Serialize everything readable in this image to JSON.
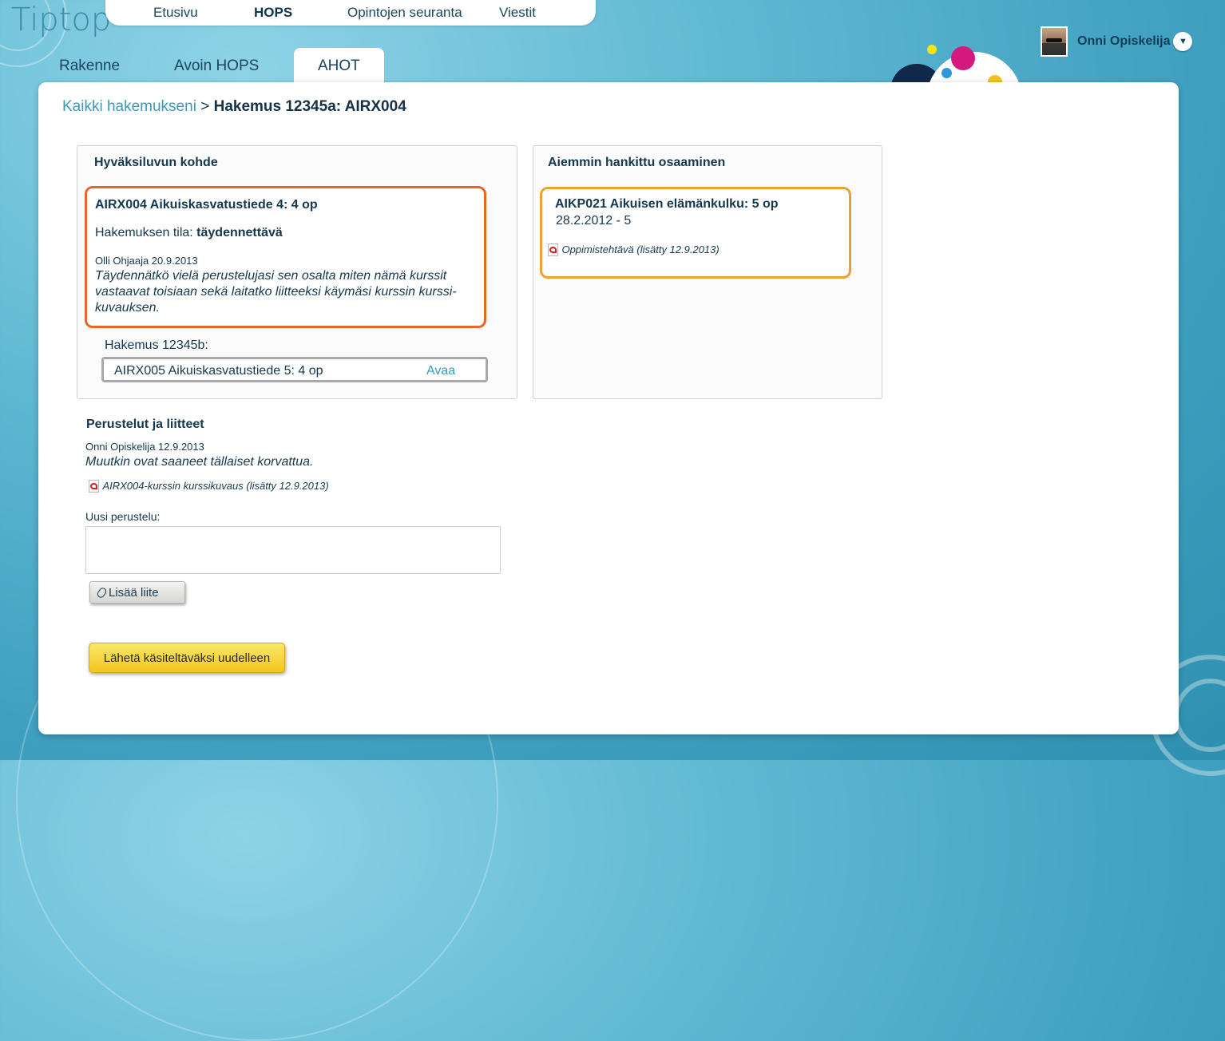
{
  "app": {
    "logo": "Tiptop"
  },
  "topnav": {
    "items": [
      {
        "label": "Etusivu",
        "active": false
      },
      {
        "label": "HOPS",
        "active": true
      },
      {
        "label": "Opintojen seuranta",
        "active": false
      },
      {
        "label": "Viestit",
        "active": false
      }
    ]
  },
  "subtabs": [
    {
      "label": "Rakenne",
      "active": false
    },
    {
      "label": "Avoin HOPS",
      "active": false
    },
    {
      "label": "AHOT",
      "active": true
    }
  ],
  "user": {
    "name": "Onni Opiskelija",
    "menu_icon": "chevron-down-icon"
  },
  "breadcrumb": {
    "link": "Kaikki hakemukseni",
    "separator": ">",
    "current": "Hakemus 12345a: AIRX004"
  },
  "target_panel": {
    "title": "Hyväksiluvun kohde",
    "course": "AIRX004 Aikuiskasvatustiede 4: 4 op",
    "status_label": "Hakemuksen tila:",
    "status_value": "täydennettävä",
    "comment_author": "Olli Ohjaaja 20.9.2013",
    "comment_text": "Täydennätkö vielä perustelujasi sen osalta miten nämä kurssit vastaavat toisiaan sekä laitatko liitteeksi käymäsi kurssin kurssi-kuvauksen.",
    "related_label": "Hakemus 12345b:",
    "related_course": "AIRX005 Aikuiskasvatustiede 5: 4 op",
    "related_open": "Avaa",
    "highlight_color": "#e5682a"
  },
  "prior_panel": {
    "title": "Aiemmin hankittu osaaminen",
    "course": "AIKP021 Aikuisen elämänkulku: 5 op",
    "date_grade": "28.2.2012 - 5",
    "attachment": "Oppimistehtävä (lisätty 12.9.2013)",
    "highlight_color": "#f0a030"
  },
  "reasons": {
    "title": "Perustelut ja liitteet",
    "author": "Onni Opiskelija 12.9.2013",
    "text": "Muutkin ovat saaneet tällaiset korvattua.",
    "attachment": "AIRX004-kurssin kurssikuvaus (lisätty 12.9.2013)",
    "new_label": "Uusi perustelu:",
    "new_value": "",
    "attach_button": "Lisää liite",
    "submit_button": "Lähetä käsiteltäväksi uudelleen"
  }
}
